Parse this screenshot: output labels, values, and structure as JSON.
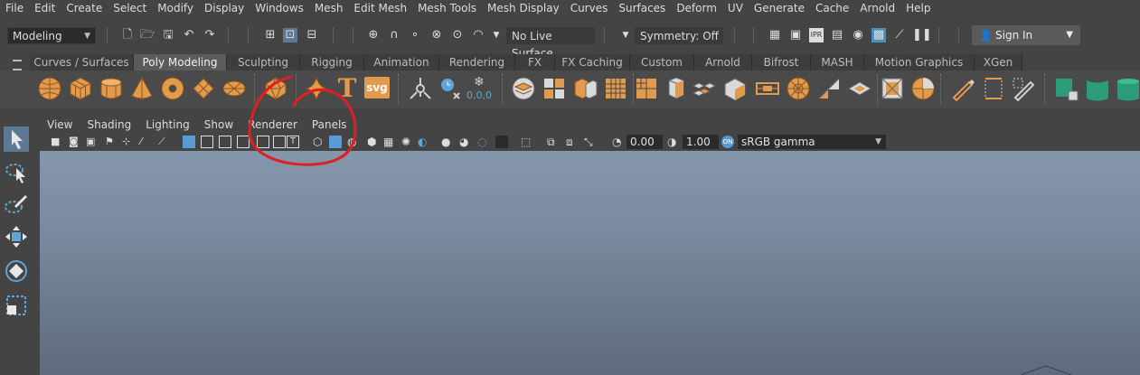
{
  "menubar": [
    "File",
    "Edit",
    "Create",
    "Select",
    "Modify",
    "Display",
    "Windows",
    "Mesh",
    "Edit Mesh",
    "Mesh Tools",
    "Mesh Display",
    "Curves",
    "Surfaces",
    "Deform",
    "UV",
    "Generate",
    "Cache",
    "Arnold",
    "Help"
  ],
  "status": {
    "mode": "Modeling",
    "live_surface": "No Live Surface",
    "symmetry": "Symmetry: Off",
    "sign_in": "Sign In"
  },
  "shelf": {
    "tabs": [
      "Curves / Surfaces",
      "Poly Modeling",
      "Sculpting",
      "Rigging",
      "Animation",
      "Rendering",
      "FX",
      "FX Caching",
      "Custom",
      "Arnold",
      "Bifrost",
      "MASH",
      "Motion Graphics",
      "XGen"
    ],
    "active_tab": "Poly Modeling",
    "svg_label": "svg",
    "text_label": "T",
    "coord_label": "0,0,0"
  },
  "panel": {
    "menu": [
      "View",
      "Shading",
      "Lighting",
      "Show",
      "Renderer",
      "Panels"
    ],
    "exposure": "0.00",
    "gamma": "1.00",
    "color_space": "sRGB gamma"
  },
  "colors": {
    "accent_orange": "#e29a4d",
    "annotation_red": "#e02020",
    "active_blue": "#5b9bd5"
  }
}
